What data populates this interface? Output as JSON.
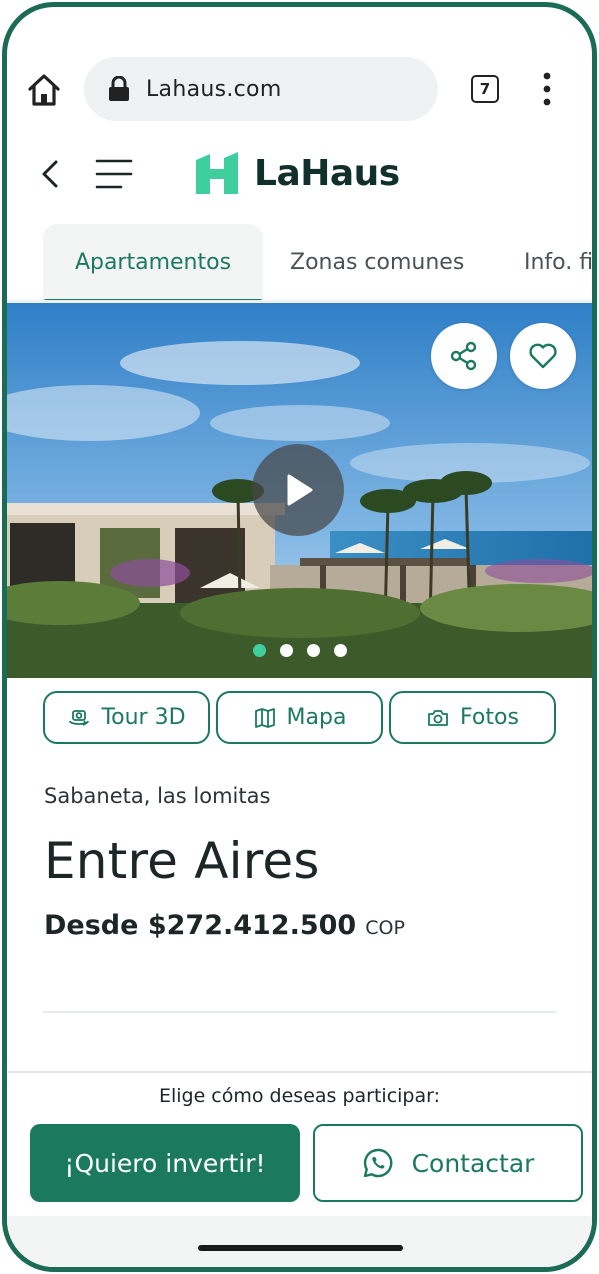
{
  "browser": {
    "url": "Lahaus.com",
    "tab_count": "7"
  },
  "header": {
    "logo_text": "LaHaus"
  },
  "tabs": [
    {
      "label": "Apartamentos",
      "active": true
    },
    {
      "label": "Zonas comunes",
      "active": false
    },
    {
      "label": "Info. fi",
      "active": false
    }
  ],
  "gallery": {
    "slide_count": 4,
    "active_slide": 1
  },
  "actions": {
    "tour": "Tour 3D",
    "mapa": "Mapa",
    "fotos": "Fotos"
  },
  "project": {
    "location": "Sabaneta, las lomitas",
    "name": "Entre Aires",
    "price": "Desde $272.412.500",
    "currency": "COP"
  },
  "cta": {
    "label": "Elige cómo deseas participar:",
    "invest": "¡Quiero invertir!",
    "contact": "Contactar"
  },
  "colors": {
    "brand": "#1b7a5e",
    "logo_green": "#3fcf9e",
    "frame": "#1b6b55"
  }
}
